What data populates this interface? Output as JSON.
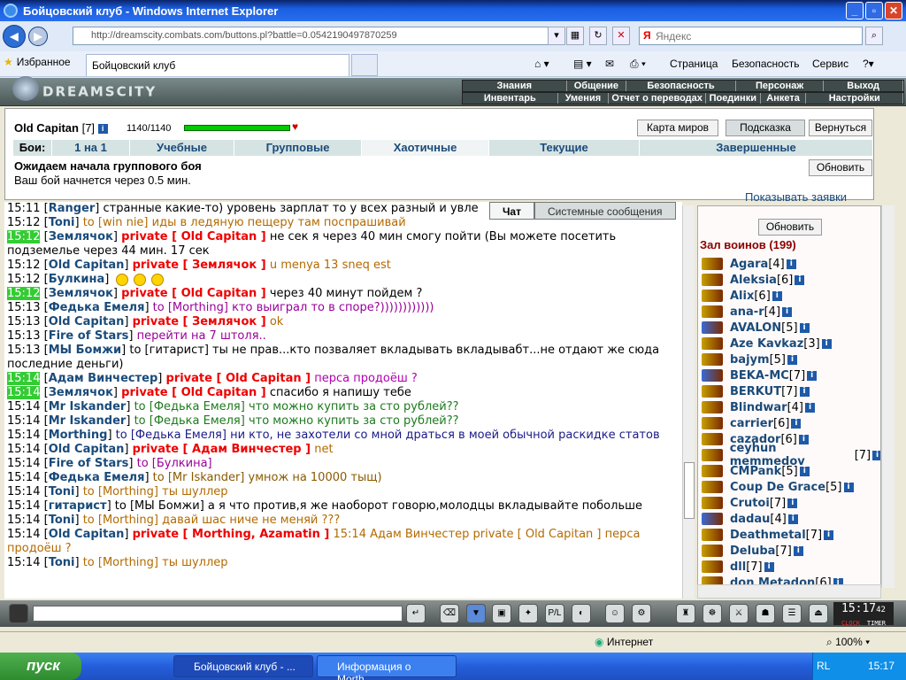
{
  "window": {
    "title": "Бойцовский клуб - Windows Internet Explorer"
  },
  "browser": {
    "address": "http://dreamscity.combats.com/buttons.pl?battle=0.0542190497870259",
    "search_placeholder": "Яндекс",
    "favorites_label": "Избранное",
    "tab_title": "Бойцовский клуб",
    "commands": [
      "Страница",
      "Безопасность",
      "Сервис"
    ]
  },
  "site": {
    "logo": "DREAMSCITY",
    "menu_top": [
      "Знания",
      "Общение",
      "Безопасность",
      "Персонаж",
      "Выход"
    ],
    "menu_bottom": [
      "Инвентарь",
      "Умения",
      "Отчет о переводах",
      "Поединки",
      "Анкета",
      "Настройки"
    ]
  },
  "battle": {
    "char_name": "Old Capitan",
    "char_level": "[7]",
    "hp": "1140/1140",
    "hp_fraction": 1.0,
    "buttons": {
      "map": "Карта миров",
      "hint": "Подсказка",
      "back": "Вернуться"
    },
    "tabs_label": "Бои:",
    "tabs": [
      "1 на 1",
      "Учебные",
      "Групповые",
      "Хаотичные",
      "Текущие",
      "Завершенные"
    ],
    "active_tab": "Хаотичные",
    "wait_title": "Ожидаем начала группового боя",
    "wait_text": "Ваш бой начнется через 0.5 мин.",
    "refresh": "Обновить",
    "show_requests": "Показывать заявки"
  },
  "chat": {
    "tabs": [
      "Чат",
      "Системные сообщения"
    ],
    "lines": [
      {
        "t": "15:11",
        "nick": "Ranger",
        "parts": [
          {
            "c": "",
            "x": "странные какие-то) уровень зарплат то у всех разный и увле"
          }
        ]
      },
      {
        "t": "15:12",
        "nick": "Toni",
        "parts": [
          {
            "c": "brown",
            "x": "to [win nie] иды в ледяную пещеру там поспрашивай"
          }
        ]
      },
      {
        "t": "15:12",
        "hl": true,
        "nick": "Землячок",
        "parts": [
          {
            "c": "priv",
            "x": "private [ Old Capitan ]"
          },
          {
            "c": "",
            "x": "не сек я через 40 мин смогу пойти (Вы можете посетить подземелье через 44 мин. 17 сек"
          }
        ]
      },
      {
        "t": "15:12",
        "nick": "Old Capitan",
        "parts": [
          {
            "c": "priv",
            "x": "private [ Землячок ]"
          },
          {
            "c": "brown",
            "x": "u menya 13 sneq est"
          }
        ]
      },
      {
        "t": "",
        "nick": "",
        "parts": [
          {
            "c": "",
            "x": " "
          }
        ]
      },
      {
        "t": "15:12",
        "nick": "Булкина",
        "smiles": 3,
        "parts": []
      },
      {
        "t": "15:12",
        "hl": true,
        "nick": "Землячок",
        "parts": [
          {
            "c": "priv",
            "x": "private [ Old Capitan ]"
          },
          {
            "c": "",
            "x": "через 40 минут пойдем ?"
          }
        ]
      },
      {
        "t": "15:13",
        "nick": "Федька Емеля",
        "parts": [
          {
            "c": "purple",
            "x": "to [Morthing] кто выиграл то в споре?))))))))))))"
          }
        ]
      },
      {
        "t": "15:13",
        "nick": "Old Capitan",
        "parts": [
          {
            "c": "priv",
            "x": "private [ Землячок ]"
          },
          {
            "c": "brown",
            "x": "ok"
          }
        ]
      },
      {
        "t": "15:13",
        "nick": "Fire of Stars",
        "parts": [
          {
            "c": "purple",
            "x": "перейти на 7 штоля.."
          }
        ]
      },
      {
        "t": "15:13",
        "nick": "МЫ Бомжи",
        "parts": [
          {
            "c": "",
            "x": "to [гитарист] ты не прав...кто позваляет вкладывать вкладывабт...не отдают же сюда последние деньги)"
          }
        ]
      },
      {
        "t": "15:14",
        "hl": true,
        "nick": "Адам Винчестер",
        "parts": [
          {
            "c": "priv",
            "x": "private [ Old Capitan ]"
          },
          {
            "c": "magenta",
            "x": "перса продоёш ?"
          }
        ]
      },
      {
        "t": "15:14",
        "hl": true,
        "nick": "Землячок",
        "parts": [
          {
            "c": "priv",
            "x": "private [ Old Capitan ]"
          },
          {
            "c": "",
            "x": "спасибо я напишу тебе"
          }
        ]
      },
      {
        "t": "15:14",
        "nick": "Mr Iskander",
        "parts": [
          {
            "c": "green",
            "x": "to [Федька Емеля] что можно купить за сто рублей??"
          }
        ]
      },
      {
        "t": "15:14",
        "nick": "Mr Iskander",
        "parts": [
          {
            "c": "green",
            "x": "to [Федька Емеля] что можно купить за сто рублей??"
          }
        ]
      },
      {
        "t": "15:14",
        "nick": "Morthing",
        "parts": [
          {
            "c": "navy",
            "x": "to [Федька Емеля] ни кто, не захотели со мной драться в моей обычной раскидке статов"
          }
        ]
      },
      {
        "t": "15:14",
        "nick": "Old Capitan",
        "parts": [
          {
            "c": "priv",
            "x": "private [ Адам Винчестер ]"
          },
          {
            "c": "brown",
            "x": "net"
          }
        ]
      },
      {
        "t": "",
        "nick": "",
        "parts": [
          {
            "c": "",
            "x": " "
          }
        ]
      },
      {
        "t": "15:14",
        "nick": "Fire of Stars",
        "parts": [
          {
            "c": "purple",
            "x": "to [Булкина]"
          }
        ]
      },
      {
        "t": "15:14",
        "nick": "Федька Емеля",
        "parts": [
          {
            "c": "olive",
            "x": "to [Mr Iskander] умнож на 10000 тыщ)"
          }
        ]
      },
      {
        "t": "15:14",
        "nick": "Toni",
        "parts": [
          {
            "c": "brown",
            "x": "to [Morthing] ты шуллер"
          }
        ]
      },
      {
        "t": "15:14",
        "nick": "гитарист",
        "parts": [
          {
            "c": "",
            "x": "to [МЫ Бомжи] а я что против,я же наоборот говорю,молодцы вкладывайте побольше"
          }
        ]
      },
      {
        "t": "15:14",
        "nick": "Toni",
        "parts": [
          {
            "c": "brown",
            "x": "to [Morthing] давай шас ниче не меняй ???"
          }
        ]
      },
      {
        "t": "15:14",
        "nick": "Old Capitan",
        "parts": [
          {
            "c": "priv",
            "x": "private [ Morthing, Azamatin ]"
          },
          {
            "c": "brown",
            "x": "15:14 Адам Винчестер private [ Old Capitan ] перса продоёш ?"
          }
        ]
      },
      {
        "t": "15:14",
        "nick": "Toni",
        "parts": [
          {
            "c": "brown",
            "x": "to [Morthing] ты шуллер"
          }
        ]
      }
    ]
  },
  "room": {
    "refresh": "Обновить",
    "title": "Зал воинов (199)",
    "players": [
      {
        "name": "Agara",
        "lv": "[4]"
      },
      {
        "name": "Aleksia",
        "lv": "[6]"
      },
      {
        "name": "Alix",
        "lv": "[6]"
      },
      {
        "name": "ana-r",
        "lv": "[4]"
      },
      {
        "name": "AVALON",
        "lv": "[5]",
        "b": true
      },
      {
        "name": "Aze Kavkaz",
        "lv": "[3]"
      },
      {
        "name": "bajym",
        "lv": "[5]"
      },
      {
        "name": "BEKA-MC",
        "lv": "[7]",
        "b": true
      },
      {
        "name": "BERKUT",
        "lv": "[7]"
      },
      {
        "name": "Blindwar",
        "lv": "[4]"
      },
      {
        "name": "carrier",
        "lv": "[6]"
      },
      {
        "name": "cazador",
        "lv": "[6]"
      },
      {
        "name": "ceyhun memmedov",
        "lv": "[7]"
      },
      {
        "name": "CMPank",
        "lv": "[5]"
      },
      {
        "name": "Coup De Grace",
        "lv": "[5]"
      },
      {
        "name": "Crutoi",
        "lv": "[7]"
      },
      {
        "name": "dadau",
        "lv": "[4]",
        "b": true
      },
      {
        "name": "Deathmetal",
        "lv": "[7]"
      },
      {
        "name": "Deluba",
        "lv": "[7]"
      },
      {
        "name": "dll",
        "lv": "[7]"
      },
      {
        "name": "don Metadon",
        "lv": "[6]"
      }
    ]
  },
  "clock": {
    "time": "15:17",
    "sec": "42",
    "label1": "CLOCK",
    "label2": "TIMER"
  },
  "status": {
    "zone": "Интернет",
    "zoom": "100%"
  },
  "taskbar": {
    "start": "пуск",
    "tasks": [
      "Бойцовский клуб - ...",
      "Информация о Morth..."
    ],
    "lang": "RL",
    "time": "15:17"
  }
}
